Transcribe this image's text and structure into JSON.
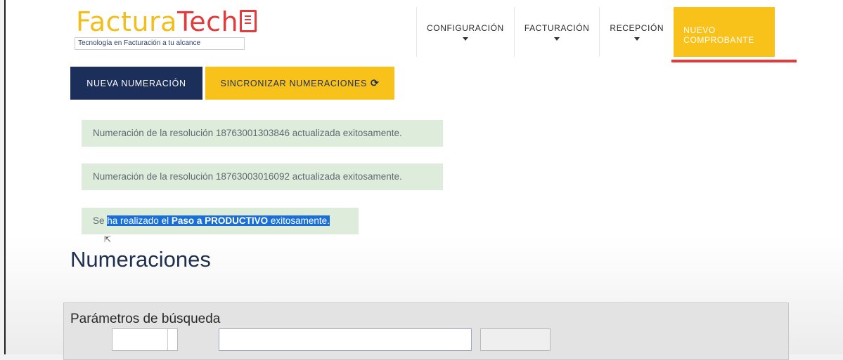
{
  "brand": {
    "name_part1": "Factura",
    "name_part2": "Tech",
    "tagline": "Tecnología en Facturación a tu alcance",
    "colors": {
      "yellow": "#f9c21a",
      "red": "#e23b3b",
      "navy": "#1c2e5a"
    }
  },
  "nav": {
    "items": [
      {
        "label": "CONFIGURACIÓN"
      },
      {
        "label": "FACTURACIÓN"
      },
      {
        "label": "RECEPCIÓN"
      }
    ],
    "active_label": "NUEVO COMPROBANTE"
  },
  "actions": {
    "new_label": "NUEVA NUMERACIÓN",
    "sync_label": "SINCRONIZAR NUMERACIONES",
    "sync_icon": "refresh-icon"
  },
  "alerts": [
    {
      "text": "Numeración de la resolución 18763001303846 actualizada exitosamente."
    },
    {
      "text": "Numeración de la resolución 18763003016092 actualizada exitosamente."
    }
  ],
  "success": {
    "prefix": "Se ",
    "mid": "ha realizado el ",
    "bold": "Paso a PRODUCTIVO",
    "suffix": " exitosamente."
  },
  "page": {
    "title": "Numeraciones",
    "search_panel_title": "Parámetros de búsqueda"
  }
}
